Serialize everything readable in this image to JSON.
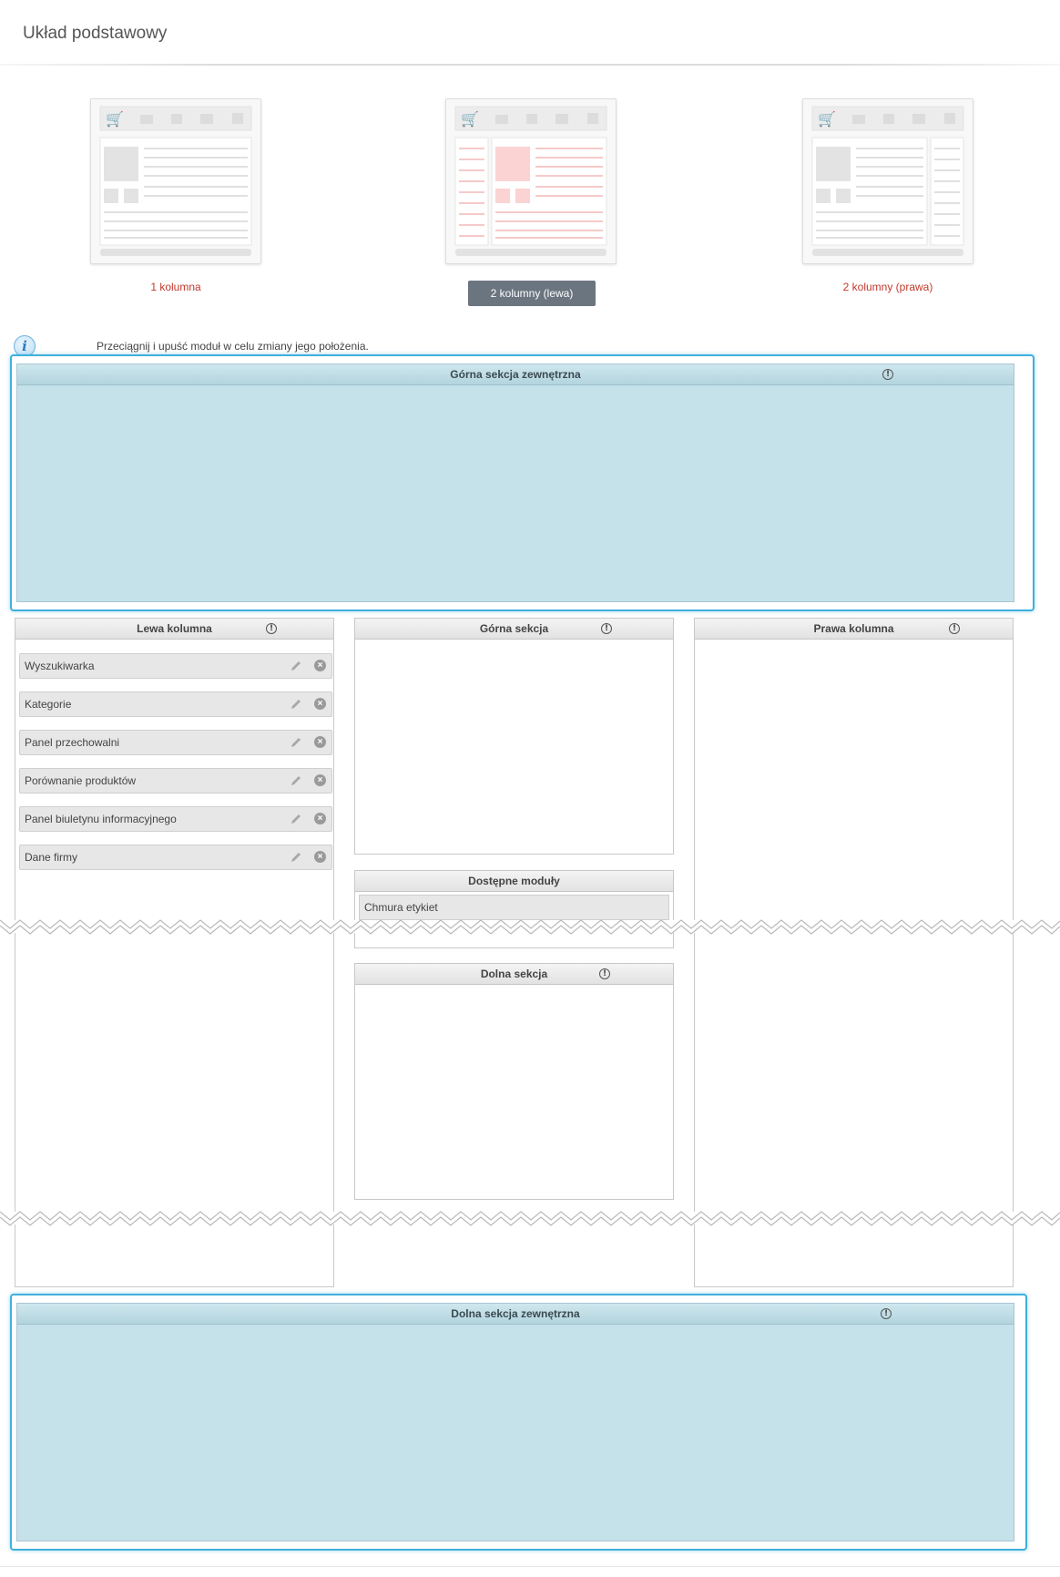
{
  "page": {
    "title": "Układ podstawowy"
  },
  "layout_options": [
    {
      "label": "1 kolumna",
      "state": "link",
      "accent": "#c0392b"
    },
    {
      "label": "2 kolumny (lewa)",
      "state": "selected",
      "accent": "#6b7580"
    },
    {
      "label": "2 kolumny (prawa)",
      "state": "link",
      "accent": "#c0392b"
    }
  ],
  "info": {
    "icon": "info-icon",
    "text": "Przeciągnij i upuść moduł w celu zmiany jego położenia."
  },
  "sections": {
    "top_outer": {
      "title": "Górna sekcja zewnętrzna",
      "info_glyph": "!"
    },
    "left_column": {
      "title": "Lewa kolumna",
      "info_glyph": "!",
      "modules": [
        {
          "label": "Wyszukiwarka"
        },
        {
          "label": "Kategorie"
        },
        {
          "label": "Panel przechowalni"
        },
        {
          "label": "Porównanie produktów"
        },
        {
          "label": "Panel biuletynu informacyjnego"
        },
        {
          "label": "Dane firmy"
        }
      ]
    },
    "top_section": {
      "title": "Górna sekcja",
      "info_glyph": "!"
    },
    "right_column": {
      "title": "Prawa kolumna",
      "info_glyph": "!"
    },
    "available_modules": {
      "title": "Dostępne moduły",
      "items": [
        {
          "label": "Chmura etykiet"
        }
      ]
    },
    "bottom_section": {
      "title": "Dolna sekcja",
      "info_glyph": "!"
    },
    "bottom_outer": {
      "title": "Dolna sekcja zewnętrzna",
      "info_glyph": "!"
    }
  },
  "colors": {
    "outer_highlight": "#3fb0dc",
    "outer_fill": "#c5e2ea",
    "link": "#c0392b",
    "selected_button": "#6b7580"
  }
}
